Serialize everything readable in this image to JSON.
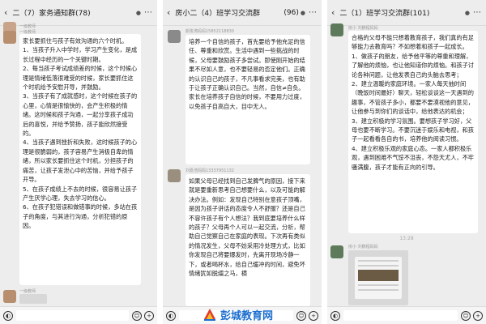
{
  "panels": [
    {
      "title": "二（7）家务通知群(78)",
      "sender_top": "一级教师",
      "sender": "一级教师",
      "sender_bottom": "一级教师",
      "paragraphs": [
        "家长要抓住与孩子有效沟通的六个时机。",
        "1、当孩子升入中学时，学习产生变化，是成长过程中经历的一个关键时期。",
        "2、每当孩子考试成绩差的时候，这个时候心理是情绪低落很难受的时候，家长要抓住这个时机给予安慰开导，并鼓励。",
        "3、当孩子有了成就感时，这个时候在孩子的心里，心情是很愉快的，会产生积极的情绪。这时候和孩子沟通，一起分享孩子成功后的喜悦，并给予赞扬，孩子能欣然接受的。",
        "4、当孩子遇到挫折和失败，这时候孩子的心理是很脆弱的，孩子容易产生消极自卑的情绪，所以家长要抓住这个时机，分担孩子的痛苦，让孩子发泄心中的苦恼，并给予孩子开导。",
        "5、在孩子成绩上不去的时候，很容易让孩子产生厌学心理，失去学习的信心。",
        "6、在孩子犯错误和做错事的时候，多站在孩子的角度，与其进行沟通，分析犯错的原因。"
      ]
    },
    {
      "title": "房小二（4）班学习交流群",
      "count": "(96)",
      "sender1": "颜俊涛妈妈15852118830",
      "sender2": "刘嘉浩妈妈13337951132",
      "bubble1": [
        "培养一个自信的孩子，首先要给予他充足的信任、尊重和欣赏。生活中遇到一些挑战的时候，父母要鼓励孩子多尝试。即使刚开始的结果不尽如人意，也不要轻易的否定他们。正确的认识自己的孩子，不凡事看求完美，也有助于让孩子正确认识自己。当然，自信≠自负。家长在培养孩子自信的时候，不要用力过度，以免孩子自高自大，目中无人。"
      ],
      "bubble2": [
        "如果父母已经找到自己发脾气的原因，接下来就是要重新思考自己想要什么，以及可能的解决办法。例如：发现自己特别在意孩子顶嘴，是因为孩子讲话的态度令人不舒服？还是自己不容许孩子有个人想法？我到底要培养什么样的孩子？父母再个人可以一起交流，分析，帮助自己觉察自己在家庭的表现。下次再有类似的情况发生，父母不妨采用冷处理方式，比如你发现自己将要爆发时，先离开现场冷静一下，或者喝杯水，给自己缓冲的时间，避免坏情绪犹如脱缰之马，横"
      ]
    },
    {
      "title": "二（1）班学习交流群(101)",
      "sender1": "房小 刘鹏程妈妈",
      "sender2": "房小 刘鹏程妈妈",
      "timestamp": "13:28",
      "paragraphs": [
        "合格的父母不能只想着教育孩子，我们真的有足够能力去教育吗？不如想着和孩子一起成长。",
        "1、做孩子的朋友，给予他平等的尊重和理解，了解他的烦恼，也让他知道你的烦恼。和孩子讨论各种问题，让他发表自己的头脑去思考；",
        "2、建立温暖的家庭环境。一家人每天抽时间（晚饭时间最好）聊天，轻松谈谈这一天遇到的趣事，不管孩子多小，都要不要漠视他的意见，让他参与到你们的谈话中，给他表达的机会；",
        "3、建立积极的学习氛围。要想孩子学习好，父母也要不断学习。不要沉迷于娱乐和电视，和孩子一起看看各自的书，培养他的阅读习惯。",
        "4、建立积极乐观的家庭心态。一家人都积极乐观，遇到困难不气馁不沮丧，不怨天尤人，不牢骚满腹，孩子才能有正向的引导。"
      ]
    }
  ],
  "input_bar": {
    "voice_icon": "voice-icon",
    "emoji_icon": "emoji-icon",
    "plus_icon": "plus-icon"
  },
  "watermark": {
    "text": "彭城教育网"
  }
}
